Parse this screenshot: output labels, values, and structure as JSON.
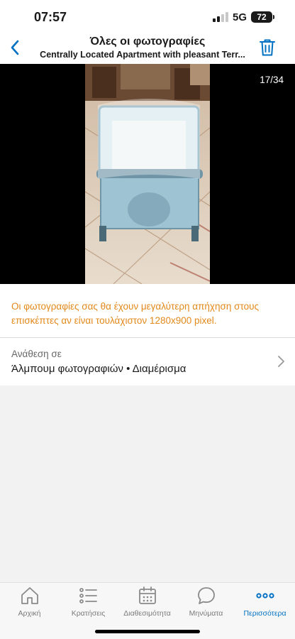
{
  "status_bar": {
    "time": "07:57",
    "network": "5G",
    "battery": "72"
  },
  "header": {
    "title": "Όλες οι φωτογραφίες",
    "subtitle": "Centrally Located Apartment with pleasant Terr...",
    "back_icon": "chevron-left-icon",
    "delete_icon": "trash-icon"
  },
  "photo_viewer": {
    "counter": "17/34"
  },
  "notice": {
    "text": "Οι φωτογραφίες σας θα έχουν μεγαλύτερη απήχηση στους επισκέπτες αν είναι τουλάχιστον 1280x900 pixel."
  },
  "assignment": {
    "label": "Ανάθεση σε",
    "value": "Άλμπουμ φωτογραφιών • Διαμέρισμα"
  },
  "tab_bar": {
    "items": [
      {
        "label": "Αρχική",
        "icon": "home-icon",
        "active": false
      },
      {
        "label": "Κρατήσεις",
        "icon": "list-icon",
        "active": false
      },
      {
        "label": "Διαθεσιμότητα",
        "icon": "calendar-icon",
        "active": false
      },
      {
        "label": "Μηνύματα",
        "icon": "chat-bubble-icon",
        "active": false
      },
      {
        "label": "Περισσότερα",
        "icon": "more-dots-icon",
        "active": true
      }
    ]
  },
  "colors": {
    "accent": "#0071c2",
    "notice": "#e2891a",
    "background": "#f2f2f2"
  }
}
